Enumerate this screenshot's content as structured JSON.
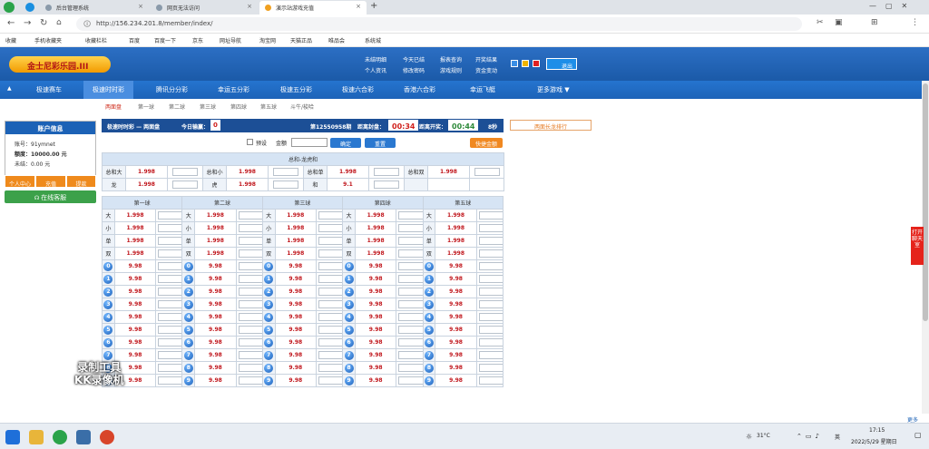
{
  "browser": {
    "tabs": [
      {
        "label": "后台管理系统"
      },
      {
        "label": "网页无法访问"
      },
      {
        "label": "演示站游戏充值"
      }
    ],
    "new_tab": "+",
    "url": "http://156.234.201.8/member/index/",
    "bookmarks": [
      "收藏",
      "手机收藏夹",
      "收藏栏栏",
      "百度",
      "百度一下",
      "京东",
      "网址导航",
      "淘宝网",
      "天猫正品",
      "唯品会",
      "系统城"
    ]
  },
  "site": {
    "logo_text": "金士尼彩乐园.III",
    "header_links_row1": [
      "未结明细",
      "今天已结",
      "报表查询",
      "开奖结果"
    ],
    "header_links_row2": [
      "个人资讯",
      "修改密码",
      "游戏规则",
      "资金变动"
    ],
    "logout": "退出",
    "menu": [
      "极速赛车",
      "极速时时彩",
      "腾讯分分彩",
      "幸运五分彩",
      "极速五分彩",
      "极速六合彩",
      "香港六合彩",
      "幸运飞艇",
      "更多游戏 ▼"
    ],
    "active_menu": "极速时时彩",
    "subtabs": [
      "两面盘",
      "第一球",
      "第二球",
      "第三球",
      "第四球",
      "第五球",
      "斗牛/梭哈"
    ]
  },
  "account": {
    "title": "账户信息",
    "items": [
      {
        "label": "账号：91ymnet"
      },
      {
        "label": "额度：10000.00 元"
      },
      {
        "label": "未结：0.00 元"
      }
    ],
    "buttons": [
      "个人中心",
      "充值",
      "提款"
    ],
    "chat": "在线客服"
  },
  "infobar": {
    "game": "极速时时彩 — 两面盘",
    "today_win_label": "今日输赢：",
    "today_win_value": "0",
    "period": "第12550958期",
    "close_label": "距离封盘：",
    "close_value": "00:34",
    "draw_label": "距离开奖：",
    "draw_value": "00:44",
    "refresh": "8秒",
    "history_button": "两面长龙排行"
  },
  "controls": {
    "preset_label": "预设",
    "amount_label": "金额",
    "confirm": "确定",
    "reset": "重置",
    "quick": "快捷金额"
  },
  "summary": {
    "header": "总和-龙虎和",
    "rows": [
      [
        {
          "l": "总和大",
          "o": "1.998"
        },
        {
          "l": "总和小",
          "o": "1.998"
        },
        {
          "l": "总和单",
          "o": "1.998"
        },
        {
          "l": "总和双",
          "o": "1.998"
        }
      ],
      [
        {
          "l": "龙",
          "o": "1.998"
        },
        {
          "l": "虎",
          "o": "1.998"
        },
        {
          "l": "和",
          "o": "9.1"
        }
      ]
    ]
  },
  "balls": {
    "headers": [
      "第一球",
      "第二球",
      "第三球",
      "第四球",
      "第五球"
    ],
    "size_rows": [
      {
        "l": "大",
        "o": "1.998"
      },
      {
        "l": "小",
        "o": "1.998"
      },
      {
        "l": "单",
        "o": "1.998"
      },
      {
        "l": "双",
        "o": "1.998"
      }
    ],
    "numbers": [
      "0",
      "1",
      "2",
      "3",
      "4",
      "5",
      "6",
      "7",
      "8",
      "9"
    ],
    "number_odds": "9.98"
  },
  "side_chat": "打开聊天室",
  "more": "更多",
  "watermark": "录制工具\nKK录像机",
  "taskbar": {
    "weather": "31°C",
    "lang": "英",
    "time": "17:15",
    "date": "2022/5/29 星期日"
  },
  "colors": {
    "header_blue": "#1c62b6",
    "odds_red": "#c0161c",
    "timer_red": "#d0201c",
    "timer_green": "#2e8a3a"
  }
}
